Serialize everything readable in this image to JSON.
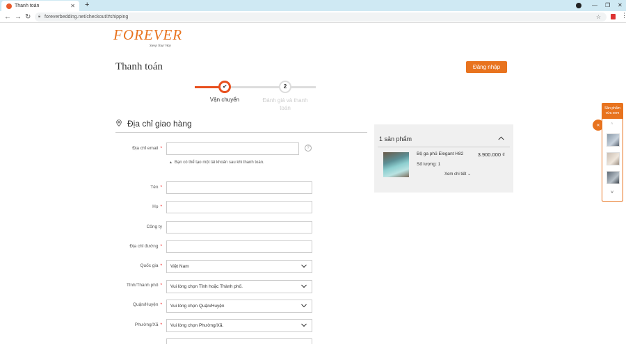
{
  "browser": {
    "tab_title": "Thanh toán",
    "url": "foreverbedding.net/checkout/#shipping"
  },
  "header": {
    "logo_text": "FOREVER",
    "logo_tagline": "Sleep Your Way",
    "page_title": "Thanh toán",
    "login_label": "Đăng nhập"
  },
  "steps": [
    {
      "label": "Vận chuyển",
      "number": "",
      "state": "done"
    },
    {
      "label": "Đánh giá và thanh toán",
      "number": "2",
      "state": "pending"
    }
  ],
  "shipping": {
    "section_title": "Địa chỉ giao hàng",
    "email_label": "Địa chỉ email",
    "email_hint": "Bạn có thể tạo một tài khoản sau khi thanh toán.",
    "first_name_label": "Tên",
    "last_name_label": "Họ",
    "company_label": "Công ty",
    "street_label": "Địa chỉ đường",
    "country_label": "Quốc gia",
    "country_value": "Việt Nam",
    "province_label": "Tỉnh/Thành phố",
    "province_value": "Vui lòng chọn Tỉnh hoặc Thành phố.",
    "district_label": "Quận/Huyện",
    "district_value": "Vui lòng chọn Quận/Huyện",
    "ward_label": "Phường/Xã",
    "ward_value": "Vui lòng chọn Phường/Xã.",
    "required_mark": "*"
  },
  "summary": {
    "title": "1 sản phẩm",
    "product_name": "Bộ ga phủ Elegant H82",
    "product_price": "3.900.000 ₫",
    "product_qty": "Số lượng: 1",
    "details_label": "Xem chi tiết"
  },
  "recent": {
    "title_line1": "Sản phẩm",
    "title_line2": "vừa xem"
  },
  "colors": {
    "accent": "#e8731e",
    "step_active": "#e8501e"
  }
}
